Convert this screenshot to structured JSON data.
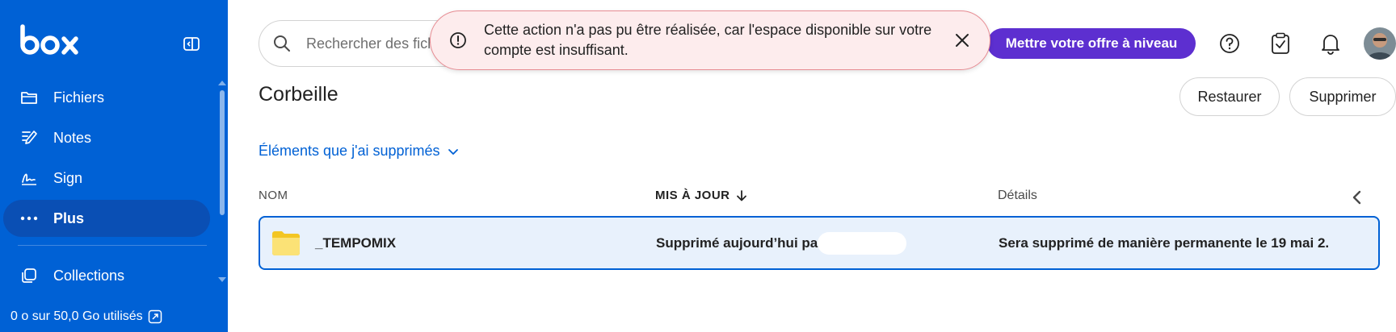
{
  "app": {
    "logo_text": "box",
    "brand_color": "#0061d5"
  },
  "sidebar": {
    "items": [
      {
        "label": "Fichiers",
        "icon": "folder-icon",
        "active": false
      },
      {
        "label": "Notes",
        "icon": "notes-icon",
        "active": false
      },
      {
        "label": "Sign",
        "icon": "sign-icon",
        "active": false
      },
      {
        "label": "Plus",
        "icon": "more-icon",
        "active": true
      },
      {
        "label": "Collections",
        "icon": "collections-icon",
        "active": false
      }
    ],
    "storage_text": "0 o sur 50,0 Go utilisés"
  },
  "header": {
    "search_placeholder": "Rechercher des fich",
    "upgrade_label": "Mettre votre offre à niveau",
    "upgrade_color": "#5d2fd0"
  },
  "toast": {
    "message": "Cette action n'a pas pu être réalisée, car l'espace disponible sur votre compte est insuffisant.",
    "background": "#fdeced",
    "border": "#e78b92"
  },
  "main": {
    "title": "Corbeille",
    "restore_label": "Restaurer",
    "delete_label": "Supprimer",
    "filter_label": "Éléments que j'ai supprimés",
    "columns": {
      "name": "NOM",
      "updated": "MIS À JOUR",
      "details": "Détails"
    },
    "rows": [
      {
        "name": "_TEMPOMIX",
        "updated": "Supprimé aujourd’hui par",
        "details": "Sera supprimé de manière permanente le 19 mai 2..."
      }
    ]
  }
}
